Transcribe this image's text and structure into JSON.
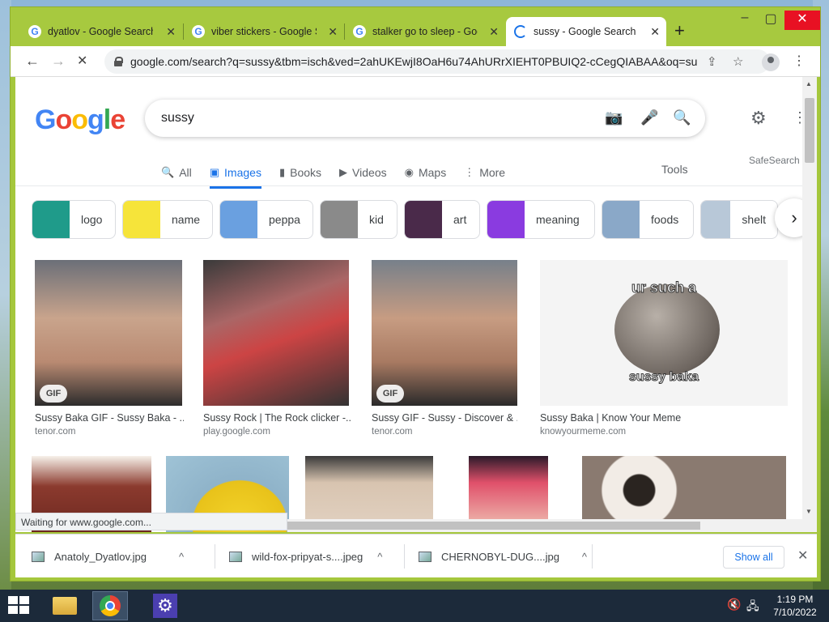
{
  "window": {
    "tabs": [
      {
        "label": "dyatlov - Google Search",
        "close": "✕"
      },
      {
        "label": "viber stickers - Google Se",
        "close": "✕"
      },
      {
        "label": "stalker go to sleep - Goo",
        "close": "✕"
      },
      {
        "label": "sussy - Google Search",
        "close": "✕"
      }
    ],
    "new_tab": "+",
    "controls": {
      "minimize": "–",
      "maximize": "▢",
      "close": "✕"
    }
  },
  "toolbar": {
    "back": "←",
    "forward": "→",
    "reload": "✕",
    "url": "google.com/search?q=sussy&tbm=isch&ved=2ahUKEwjI8OaH6u74AhURrXIEHT0PBUIQ2-cCegQIABAA&oq=su...",
    "share_icon": "⇪",
    "star_icon": "☆",
    "menu_icon": "⋮"
  },
  "google": {
    "logo": [
      "G",
      "o",
      "o",
      "g",
      "l",
      "e"
    ],
    "query": "sussy",
    "camera_icon": "📷",
    "mic_icon": "🎤",
    "search_icon": "🔍",
    "settings_icon": "⚙",
    "apps_icon": "⋮⋮"
  },
  "nav": {
    "items": [
      {
        "icon": "🔍",
        "label": "All"
      },
      {
        "icon": "▣",
        "label": "Images"
      },
      {
        "icon": "▮",
        "label": "Books"
      },
      {
        "icon": "▶",
        "label": "Videos"
      },
      {
        "icon": "◉",
        "label": "Maps"
      },
      {
        "icon": "⋮",
        "label": "More"
      }
    ],
    "tools": "Tools",
    "safesearch": "SafeSearch"
  },
  "chips": [
    {
      "label": "logo",
      "color": "#1f9b8a"
    },
    {
      "label": "name",
      "color": "#f6e43a"
    },
    {
      "label": "peppa",
      "color": "#6aa0e0"
    },
    {
      "label": "kid",
      "color": "#8a8a8a"
    },
    {
      "label": "art",
      "color": "#4a2a4a"
    },
    {
      "label": "meaning",
      "color": "#8a3be0"
    },
    {
      "label": "foods",
      "color": "#8aa8c8"
    },
    {
      "label": "shelt",
      "color": "#b8c8d8"
    }
  ],
  "chip_next": "›",
  "results": [
    {
      "title": "Sussy Baka GIF - Sussy Baka - ...",
      "source": "tenor.com",
      "gif": "GIF"
    },
    {
      "title": "Sussy Rock | The Rock clicker -...",
      "source": "play.google.com"
    },
    {
      "title": "Sussy GIF - Sussy - Discover & ...",
      "source": "tenor.com",
      "gif": "GIF"
    },
    {
      "title": "Sussy Baka | Know Your Meme",
      "source": "knowyourmeme.com",
      "caption_top": "ur such a",
      "caption_bottom": "sussy baka"
    }
  ],
  "status": "Waiting for www.google.com...",
  "downloads": {
    "items": [
      {
        "name": "Anatoly_Dyatlov.jpg",
        "caret": "^"
      },
      {
        "name": "wild-fox-pripyat-s....jpeg",
        "caret": "^"
      },
      {
        "name": "CHERNOBYL-DUG....jpg",
        "caret": "^"
      }
    ],
    "show_all": "Show all",
    "close": "✕"
  },
  "taskbar": {
    "time": "1:19 PM",
    "date": "7/10/2022",
    "volume_icon": "🔇",
    "network_icon": "🖧"
  }
}
